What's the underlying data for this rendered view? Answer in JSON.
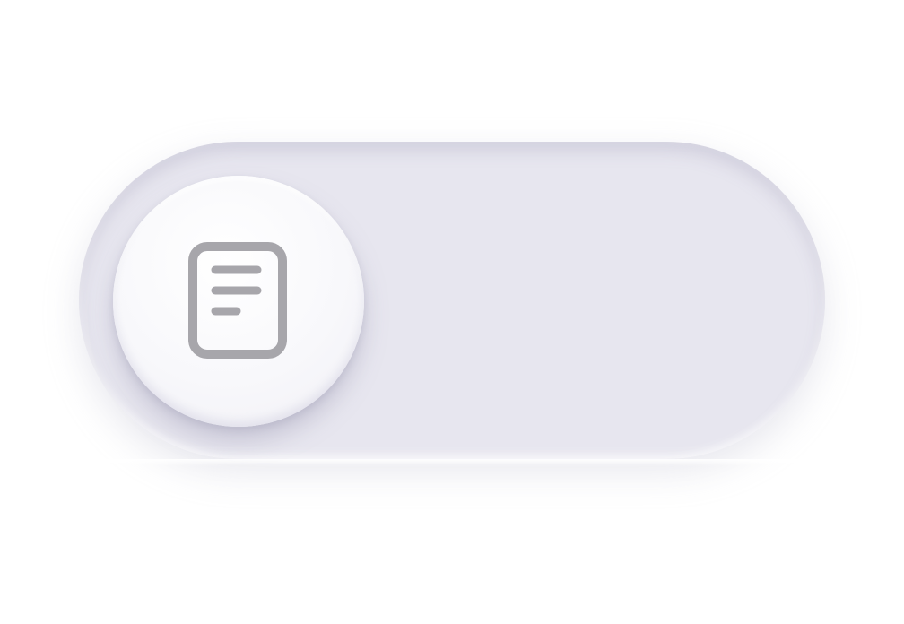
{
  "toggle": {
    "state": "off",
    "knob_icon": "document-icon",
    "track_color": "#e7e6ef",
    "knob_color": "#f8f8fb",
    "icon_color": "#a7a6ab"
  }
}
